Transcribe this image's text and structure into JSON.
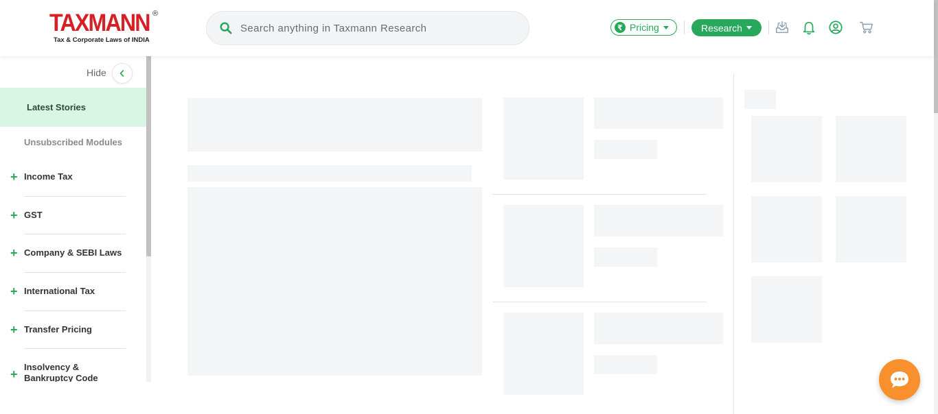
{
  "brand": {
    "name": "TAXMANN",
    "registered": "®",
    "tagline": "Tax & Corporate Laws of INDIA",
    "color": "#d71f26"
  },
  "search": {
    "placeholder": "Search anything in Taxmann Research"
  },
  "header": {
    "pricing_label": "Pricing",
    "pricing_symbol": "₹",
    "research_label": "Research",
    "icons": [
      "inbox-icon",
      "bell-icon",
      "user-icon",
      "cart-icon"
    ],
    "accent": "#27a85a"
  },
  "sidebar": {
    "hide_label": "Hide",
    "latest_label": "Latest Stories",
    "unsubscribed_label": "Unsubscribed Modules",
    "items": [
      {
        "label": "Income Tax"
      },
      {
        "label": "GST"
      },
      {
        "label": "Company & SEBI Laws"
      },
      {
        "label": "International Tax"
      },
      {
        "label": "Transfer Pricing"
      },
      {
        "label": "Insolvency & Bankruptcy Code"
      }
    ]
  },
  "chat": {
    "icon": "chat-icon",
    "color": "#f7902d"
  }
}
